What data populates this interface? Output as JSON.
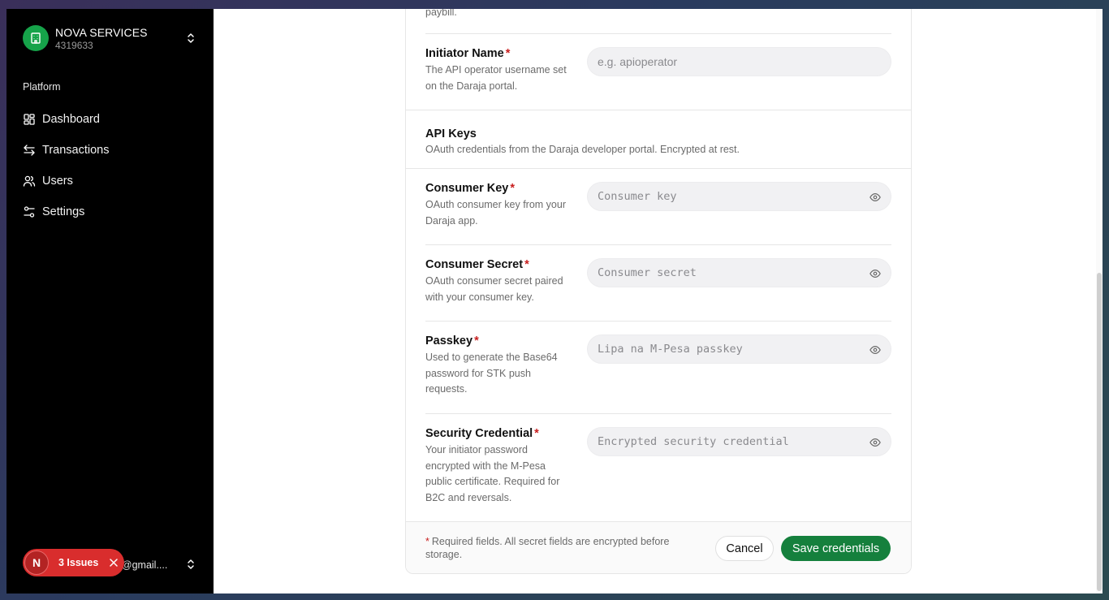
{
  "sidebar": {
    "org_name": "NOVA SERVICES",
    "org_id": "4319633",
    "section_label": "Platform",
    "nav": [
      {
        "label": "Dashboard",
        "icon": "dashboard-icon"
      },
      {
        "label": "Transactions",
        "icon": "arrows-left-right-icon"
      },
      {
        "label": "Users",
        "icon": "users-icon"
      },
      {
        "label": "Settings",
        "icon": "settings-sliders-icon"
      }
    ],
    "user_email": "56@gmail...."
  },
  "form": {
    "top_partial_text": "paybill.",
    "initiator": {
      "label": "Initiator Name",
      "help": "The API operator username set on the Daraja portal.",
      "placeholder": "e.g. apioperator"
    },
    "api_keys": {
      "title": "API Keys",
      "description": "OAuth credentials from the Daraja developer portal. Encrypted at rest."
    },
    "consumer_key": {
      "label": "Consumer Key",
      "help": "OAuth consumer key from your Daraja app.",
      "placeholder": "Consumer key"
    },
    "consumer_secret": {
      "label": "Consumer Secret",
      "help": "OAuth consumer secret paired with your consumer key.",
      "placeholder": "Consumer secret"
    },
    "passkey": {
      "label": "Passkey",
      "help": "Used to generate the Base64 password for STK push requests.",
      "placeholder": "Lipa na M-Pesa passkey"
    },
    "security_credential": {
      "label": "Security Credential",
      "help": "Your initiator password encrypted with the M-Pesa public certificate. Required for B2C and reversals.",
      "placeholder": "Encrypted security credential"
    },
    "required_marker": "*",
    "footer_note": "Required fields. All secret fields are encrypted before storage.",
    "cancel_label": "Cancel",
    "save_label": "Save credentials"
  },
  "issues_badge": {
    "logo": "N",
    "label": "3 Issues"
  },
  "colors": {
    "accent": "#15803d",
    "org_logo": "#16a34a",
    "required": "#c81e1e",
    "issues_bg": "#d92d2d"
  }
}
